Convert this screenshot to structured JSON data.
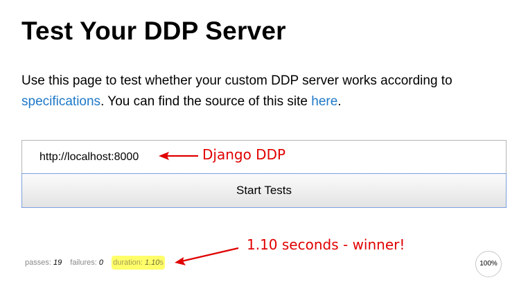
{
  "page": {
    "title": "Test Your DDP Server",
    "intro_part1": "Use this page to test whether your custom DDP server works according to ",
    "spec_link": "specifications",
    "intro_part2": ". You can find the source of this site ",
    "source_link": "here",
    "intro_part3": "."
  },
  "form": {
    "url_value": "http://localhost:8000",
    "start_label": "Start Tests"
  },
  "annotations": {
    "server_label": "Django DDP",
    "winner_label": "1.10 seconds - winner!",
    "color": "#e00000"
  },
  "stats": {
    "passes_label": "passes:",
    "passes_value": "19",
    "failures_label": "failures:",
    "failures_value": "0",
    "duration_label": "duration:",
    "duration_value": "1.10",
    "duration_unit": "s",
    "highlight_color": "#ffff6a",
    "progress": "100%"
  },
  "colors": {
    "link": "#1e78c8",
    "button_border": "#7a9fe0"
  }
}
